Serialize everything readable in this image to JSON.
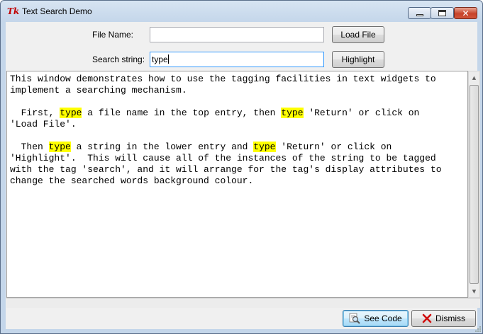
{
  "window": {
    "title": "Text Search Demo",
    "logo": "Tk",
    "controls": {
      "minimize": "minimize-icon",
      "maximize": "maximize-icon",
      "close": "close-icon"
    }
  },
  "form": {
    "file_label": "File Name:",
    "file_value": "",
    "load_button": "Load File",
    "search_label": "Search string:",
    "search_value": "type",
    "highlight_button": "Highlight"
  },
  "text": {
    "highlight_color": "#ffff00",
    "highlight_word": "type",
    "lines": [
      "This window demonstrates how to use the tagging facilities in text widgets to",
      "implement a searching mechanism.",
      "",
      "  First, type a file name in the top entry, then type 'Return' or click on",
      "'Load File'.",
      "",
      "  Then type a string in the lower entry and type 'Return' or click on",
      "'Highlight'.  This will cause all of the instances of the string to be tagged",
      "with the tag 'search', and it will arrange for the tag's display attributes to",
      "change the searched words background colour."
    ]
  },
  "buttons": {
    "see_code": "See Code",
    "dismiss": "Dismiss"
  }
}
